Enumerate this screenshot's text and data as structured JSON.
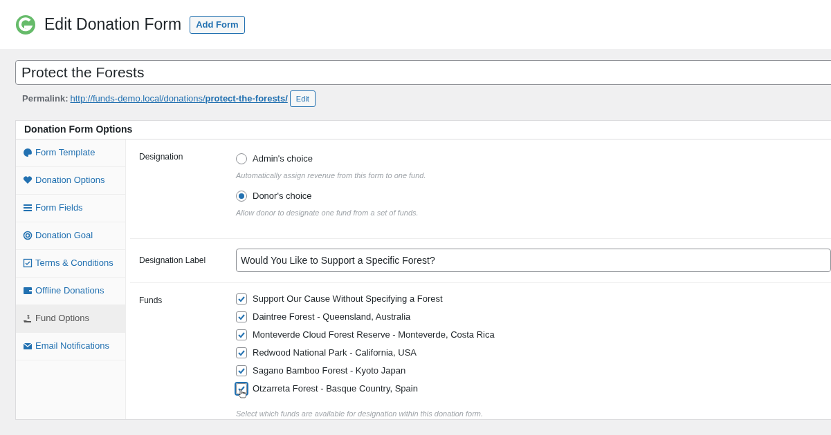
{
  "header": {
    "title": "Edit Donation Form",
    "add_button": "Add Form"
  },
  "post_title": "Protect the Forests",
  "permalink": {
    "label": "Permalink:",
    "url": "http://funds-demo.local/donations/**protect-the-forests/**",
    "edit_button": "Edit"
  },
  "panel": {
    "title": "Donation Form Options",
    "sidebar": {
      "items": [
        {
          "label": "Form Template",
          "selected": false
        },
        {
          "label": "Donation Options",
          "selected": false
        },
        {
          "label": "Form Fields",
          "selected": false
        },
        {
          "label": "Donation Goal",
          "selected": false
        },
        {
          "label": "Terms & Conditions",
          "selected": false
        },
        {
          "label": "Offline Donations",
          "selected": false
        },
        {
          "label": "Fund Options",
          "selected": true
        },
        {
          "label": "Email Notifications",
          "selected": false
        }
      ]
    },
    "designation": {
      "label": "Designation",
      "options": [
        {
          "label": "Admin's choice",
          "selected": false,
          "description": "Automatically assign revenue from this form to one fund."
        },
        {
          "label": "Donor's choice",
          "selected": true,
          "description": "Allow donor to designate one fund from a set of funds."
        }
      ]
    },
    "designation_label": {
      "label": "Designation Label",
      "value": "Would You Like to Support a Specific Forest?"
    },
    "funds": {
      "label": "Funds",
      "items": [
        {
          "label": "Support Our Cause Without Specifying a Forest",
          "checked": true,
          "focused": false
        },
        {
          "label": "Daintree Forest - Queensland, Australia",
          "checked": true,
          "focused": false
        },
        {
          "label": "Monteverde Cloud Forest Reserve - Monteverde, Costa Rica",
          "checked": true,
          "focused": false
        },
        {
          "label": "Redwood National Park - California, USA",
          "checked": true,
          "focused": false
        },
        {
          "label": "Sagano Bamboo Forest - Kyoto Japan",
          "checked": true,
          "focused": false
        },
        {
          "label": "Otzarreta Forest - Basque Country, Spain",
          "checked": true,
          "focused": true
        }
      ],
      "description": "Select which funds are available for designation within this donation form."
    }
  }
}
